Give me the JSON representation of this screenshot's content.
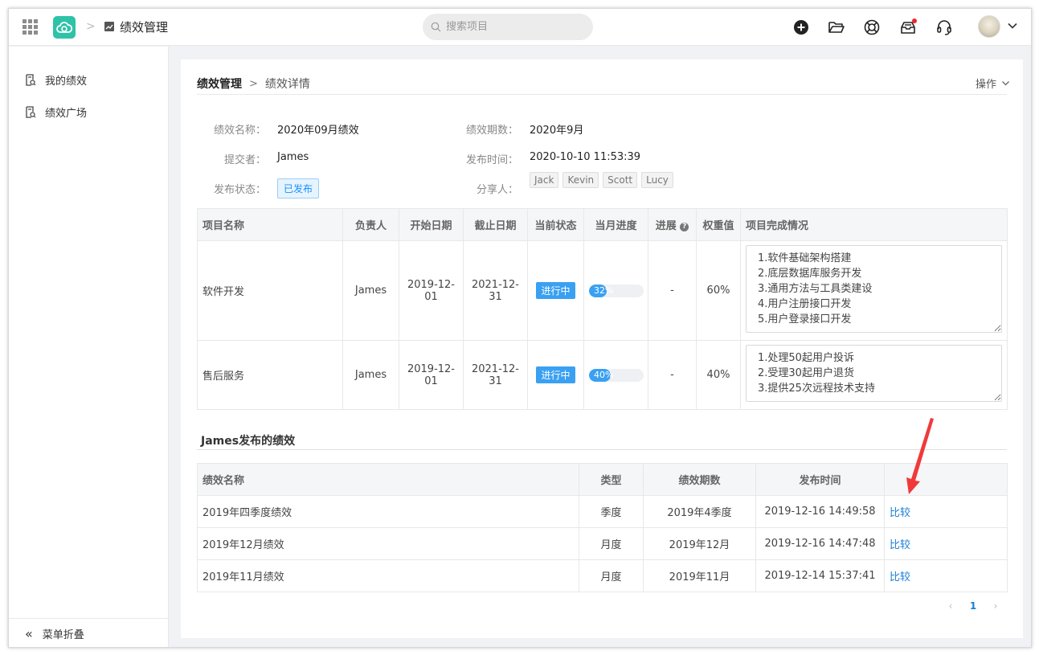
{
  "header": {
    "app_title": "绩效管理",
    "search_placeholder": "搜索项目"
  },
  "sidebar": {
    "items": [
      {
        "label": "我的绩效"
      },
      {
        "label": "绩效广场"
      }
    ],
    "collapse_label": "菜单折叠"
  },
  "breadcrumb": {
    "root": "绩效管理",
    "current": "绩效详情"
  },
  "operations_label": "操作",
  "details": {
    "name_label": "绩效名称：",
    "name_value": "2020年09月绩效",
    "period_label": "绩效期数：",
    "period_value": "2020年9月",
    "submitter_label": "提交者：",
    "submitter_value": "James",
    "publish_time_label": "发布时间：",
    "publish_time_value": "2020-10-10 11:53:39",
    "status_label": "发布状态：",
    "status_value": "已发布",
    "sharers_label": "分享人：",
    "sharers": [
      "Jack",
      "Kevin",
      "Scott",
      "Lucy"
    ]
  },
  "projects_table": {
    "headers": {
      "name": "项目名称",
      "owner": "负责人",
      "start": "开始日期",
      "end": "截止日期",
      "status": "当前状态",
      "monthly_progress": "当月进度",
      "progress": "进展",
      "weight": "权重值",
      "completion": "项目完成情况"
    },
    "rows": [
      {
        "name": "软件开发",
        "owner": "James",
        "start": "2019-12-01",
        "end": "2021-12-31",
        "status": "进行中",
        "progress_pct": 32,
        "progress_label": "32%",
        "progress_dash": "-",
        "weight": "60%",
        "completion": "1.软件基础架构搭建\n2.底层数据库服务开发\n3.通用方法与工具类建设\n4.用户注册接口开发\n5.用户登录接口开发"
      },
      {
        "name": "售后服务",
        "owner": "James",
        "start": "2019-12-01",
        "end": "2021-12-31",
        "status": "进行中",
        "progress_pct": 40,
        "progress_label": "40%",
        "progress_dash": "-",
        "weight": "40%",
        "completion": "1.处理50起用户投诉\n2.受理30起用户退货\n3.提供25次远程技术支持"
      }
    ]
  },
  "published_section": {
    "title": "James发布的绩效",
    "headers": {
      "name": "绩效名称",
      "type": "类型",
      "period": "绩效期数",
      "time": "发布时间"
    },
    "rows": [
      {
        "name": "2019年四季度绩效",
        "type": "季度",
        "period": "2019年4季度",
        "time": "2019-12-16 14:49:58",
        "action": "比较"
      },
      {
        "name": "2019年12月绩效",
        "type": "月度",
        "period": "2019年12月",
        "time": "2019-12-16 14:47:48",
        "action": "比较"
      },
      {
        "name": "2019年11月绩效",
        "type": "月度",
        "period": "2019年11月",
        "time": "2019-12-14 15:37:41",
        "action": "比较"
      }
    ]
  },
  "pagination": {
    "prev": "‹",
    "current": "1",
    "next": "›"
  }
}
